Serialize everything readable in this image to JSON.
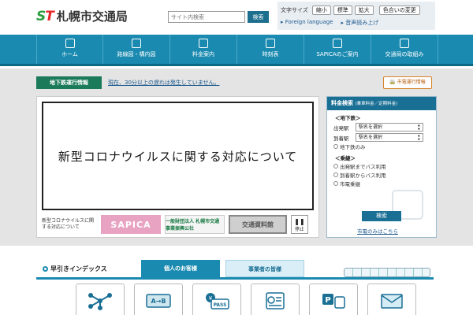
{
  "header": {
    "logo_mark": "ST",
    "logo_text": "札幌市交通局",
    "search_placeholder": "サイト内検索",
    "search_button": "検索",
    "text_size_label": "文字サイズ",
    "size_small": "縮小",
    "size_standard": "標準",
    "size_large": "拡大",
    "color_change": "色合いの変更",
    "foreign_language": "Foreign language",
    "read_aloud": "音声読み上げ"
  },
  "nav": {
    "items": [
      {
        "label": "ホーム",
        "icon": "home-icon"
      },
      {
        "label": "路線図・構内図",
        "icon": "map-icon"
      },
      {
        "label": "料金案内",
        "icon": "fare-icon"
      },
      {
        "label": "時刻表",
        "icon": "clock-icon"
      },
      {
        "label": "SAPICAのご案内",
        "icon": "card-icon"
      },
      {
        "label": "交通局の取組み",
        "icon": "train-icon"
      }
    ]
  },
  "subway_info": {
    "tag": "地下鉄運行情報",
    "message": "現在、30分以上の遅れは発生していません。",
    "streetcar_button": "市電運行情報"
  },
  "banner": {
    "title": "新型コロナウイルスに関する対応について",
    "caption": "新型コロナウイルスに関する対応について",
    "sapica_small": "ICカード乗車券",
    "sapica": "SAPICA",
    "assoc": "一般財団法人 札幌市交通事業振興公社",
    "museum": "交通資料館",
    "pause_label": "停止"
  },
  "fare": {
    "title": "料金検索",
    "subtitle": "(乗車料金／定期料金)",
    "subway_section": "＜地下鉄＞",
    "departure_label": "出発駅",
    "arrival_label": "到着駅",
    "select_placeholder": "駅名を選択",
    "subway_only": "地下鉄のみ",
    "transfer_section": "＜乗継＞",
    "opt_bus_to_dep": "出発駅までバス利用",
    "opt_bus_from_arr": "到着駅からバス利用",
    "opt_streetcar_transfer": "市電乗継",
    "search_button": "検索",
    "streetcar_only_link": "市電のみはこちら"
  },
  "index": {
    "title": "早引きインデックス",
    "tab_individual": "個人のお客様",
    "tab_business": "事業者の皆様",
    "tiles": [
      {
        "icon": "route-map-icon"
      },
      {
        "icon": "ticket-icon",
        "text": "A→B"
      },
      {
        "icon": "pass-icon",
        "text": "PASS"
      },
      {
        "icon": "timetable-icon"
      },
      {
        "icon": "parking-icon",
        "text": "P"
      },
      {
        "icon": "mail-icon"
      }
    ]
  }
}
